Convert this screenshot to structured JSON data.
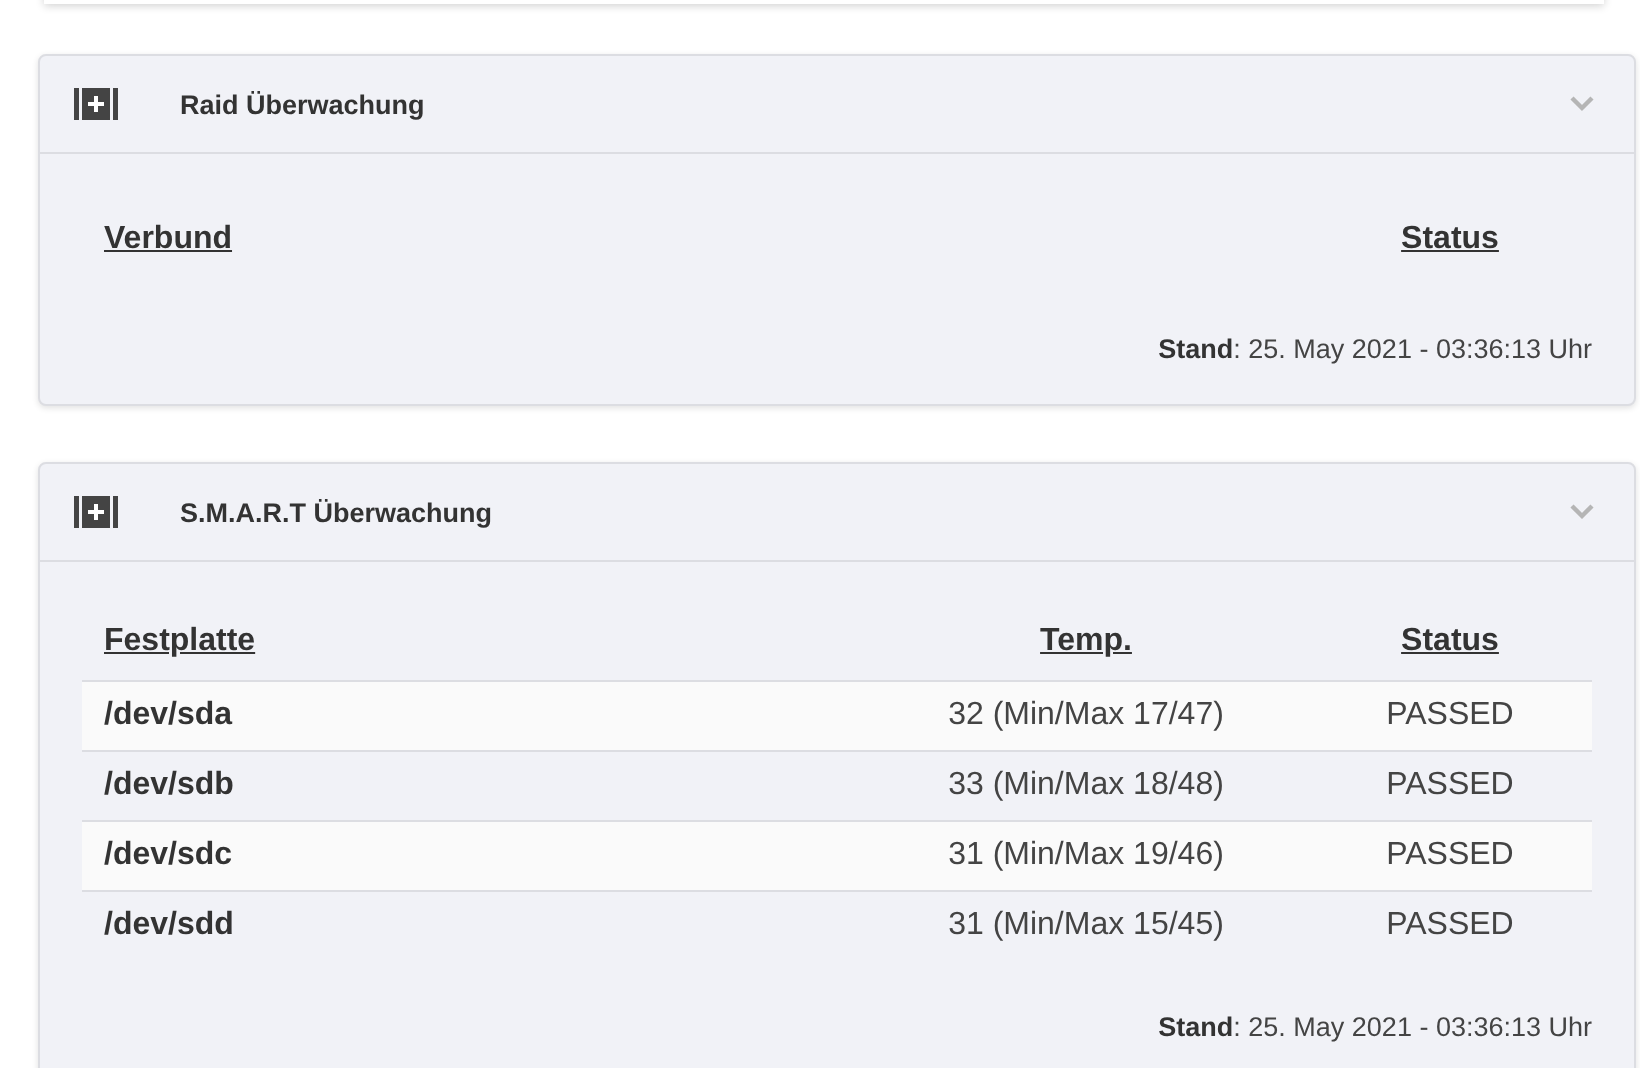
{
  "panels": [
    {
      "title": "Raid Überwachung",
      "columns": [
        "Verbund",
        "Status"
      ],
      "footer": "**Stand**: 25. May 2021 - 03:36:13 Uhr"
    },
    {
      "title": "S.M.A.R.T Überwachung",
      "columns": [
        "Festplatte",
        "Temp.",
        "Status"
      ],
      "rows": [
        [
          "/dev/sda",
          "32 (Min/Max 17/47)",
          "PASSED"
        ],
        [
          "/dev/sdb",
          "33 (Min/Max 18/48)",
          "PASSED"
        ],
        [
          "/dev/sdc",
          "31 (Min/Max 19/46)",
          "PASSED"
        ],
        [
          "/dev/sdd",
          "31 (Min/Max 15/45)",
          "PASSED"
        ]
      ],
      "footer": "**Stand**: 25. May 2021 - 03:36:13 Uhr"
    }
  ]
}
